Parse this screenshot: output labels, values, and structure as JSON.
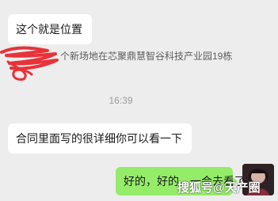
{
  "messages": {
    "first": "这个就是位置",
    "location_text": "个新场地在芯聚鼎慧智谷科技产业园19栋",
    "time": "16:39",
    "second": "合同里面写的很详细你可以看一下",
    "mine": "好的，好的，一会去看了"
  },
  "watermark": "搜狐号@天产圈",
  "colors": {
    "background": "#ededed",
    "other_bubble": "#ffffff",
    "my_bubble": "#95ec69",
    "scribble": "#e8323a"
  }
}
